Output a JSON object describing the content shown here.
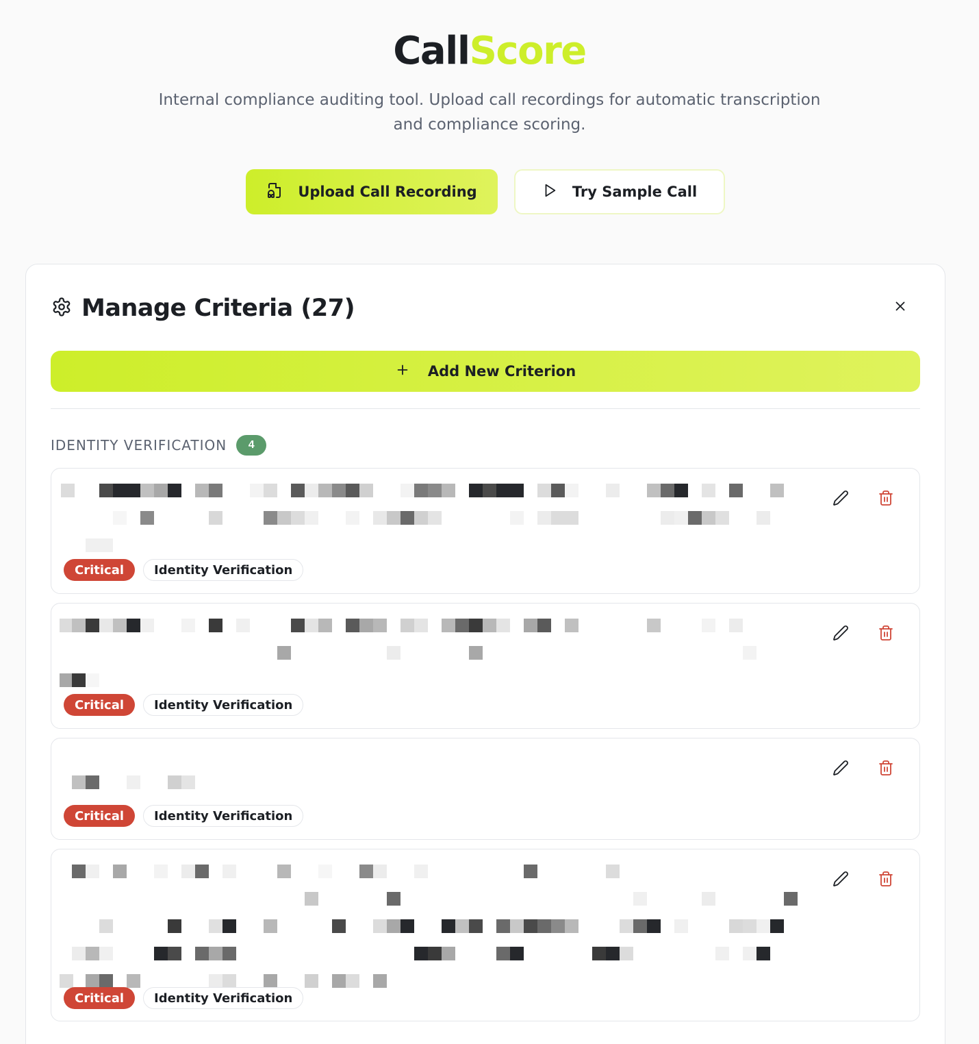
{
  "header": {
    "logo_part_a": "Call",
    "logo_part_b": "Score",
    "subtitle": "Internal compliance auditing tool. Upload call recordings for automatic transcription and compliance scoring."
  },
  "actions": {
    "upload_label": "Upload Call Recording",
    "sample_label": "Try Sample Call"
  },
  "panel": {
    "title": "Manage Criteria (27)",
    "add_label": "Add New Criterion"
  },
  "section": {
    "title": "IDENTITY VERIFICATION",
    "count": "4"
  },
  "criteria": [
    {
      "severity": "Critical",
      "category": "Identity Verification"
    },
    {
      "severity": "Critical",
      "category": "Identity Verification"
    },
    {
      "severity": "Critical",
      "category": "Identity Verification"
    },
    {
      "severity": "Critical",
      "category": "Identity Verification"
    }
  ],
  "icons": {
    "upload": "file-audio-icon",
    "sample": "play-icon",
    "settings": "gear-icon",
    "close": "close-icon",
    "add": "plus-icon",
    "edit": "pencil-icon",
    "delete": "trash-icon"
  },
  "colors": {
    "accent": "#cdee2a",
    "critical": "#cf4636",
    "count_badge": "#5b9b6b",
    "delete_icon": "#cf4636"
  }
}
